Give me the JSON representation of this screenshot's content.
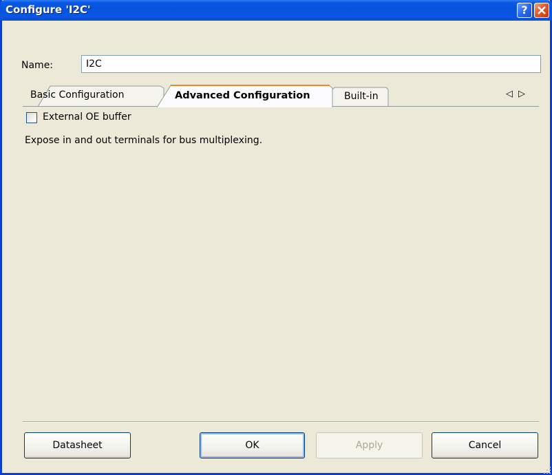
{
  "window": {
    "title": "Configure 'I2C'",
    "help_glyph": "?",
    "title_bar_color": "#0a56e3",
    "close_button_color": "#e35a2c"
  },
  "name_field": {
    "label": "Name:",
    "value": "I2C"
  },
  "tabs": {
    "items": [
      {
        "label": "Basic Configuration",
        "selected": false
      },
      {
        "label": "Advanced Configuration",
        "selected": true
      },
      {
        "label": "Built-in",
        "selected": false
      }
    ],
    "scroll_left_glyph": "◁",
    "scroll_right_glyph": "▷"
  },
  "advanced": {
    "external_oe_label": "External OE buffer",
    "external_oe_checked": false,
    "description": "Expose in and out terminals for bus multiplexing."
  },
  "buttons": {
    "datasheet": "Datasheet",
    "ok": "OK",
    "apply": "Apply",
    "cancel": "Cancel",
    "apply_enabled": false
  }
}
